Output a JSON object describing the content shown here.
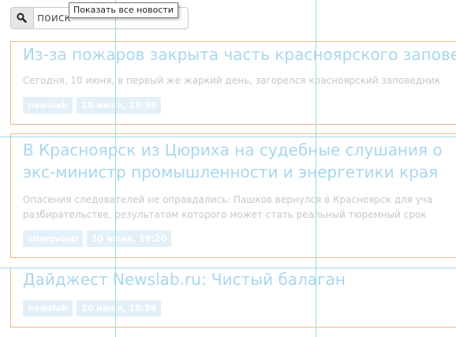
{
  "search": {
    "placeholder": "поиск",
    "tooltip": "Показать все новости"
  },
  "news": [
    {
      "title": "Из-за пожаров закрыта часть красноярского заповедника",
      "text": "Сегодня, 10 июня, в первый же жаркий день, загорелся красноярский заповедник",
      "source": "newslab",
      "date": "10 июня, 19:56"
    },
    {
      "title_line1": "В Красноярск из Цюриха на судебные слушания о",
      "title_line2": "экс-министр промышленности и энергетики края",
      "text_line1": "Опасения следователей не оправдались: Пашков вернулся в Красноярск для уча",
      "text_line2": "разбирательстве, результатом которого может стать реальный тюремный срок",
      "source": "sibnovosti",
      "date": "10 июня, 19:20"
    },
    {
      "title": "Дайджест Newslab.ru: Чистый балаган",
      "source": "newslab",
      "date": "10 июня, 18:59"
    }
  ]
}
